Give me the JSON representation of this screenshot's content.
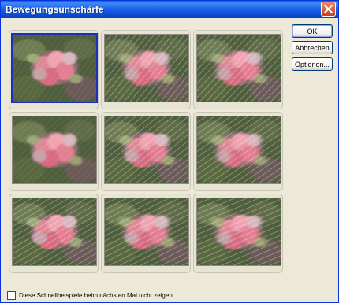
{
  "window": {
    "title": "Bewegungsunschärfe"
  },
  "buttons": {
    "ok": "OK",
    "cancel": "Abbrechen",
    "options": "Optionen..."
  },
  "checkbox": {
    "label": "Diese Schnellbeispiele beim nächsten Mal nicht zeigen",
    "checked": false
  },
  "thumbnails": {
    "count": 9,
    "selected_index": 0,
    "subject": "pink flowers with green foliage, motion-blurred"
  },
  "colors": {
    "title_bar": "#0A5FE4",
    "dialog_bg": "#ECE9D8",
    "selection_border": "#1C2FC1",
    "close_button": "#D9593A"
  }
}
